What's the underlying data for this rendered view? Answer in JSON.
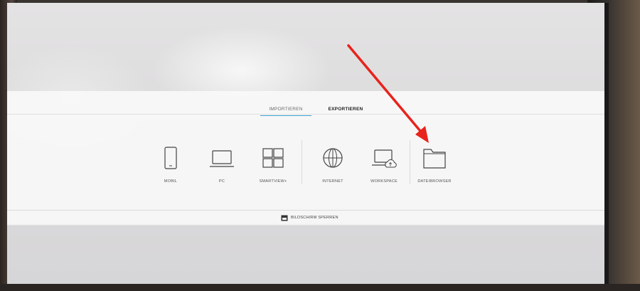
{
  "tabs": [
    {
      "label": "IMPORTIEREN",
      "active": true
    },
    {
      "label": "EXPORTIEREN",
      "active": false
    }
  ],
  "sources": [
    {
      "label": "MOBIL",
      "icon": "phone-icon"
    },
    {
      "label": "PC",
      "icon": "laptop-icon"
    },
    {
      "label": "SMARTVIEW+",
      "icon": "grid-icon"
    },
    {
      "label": "INTERNET",
      "icon": "globe-icon"
    },
    {
      "label": "WORKSPACE",
      "icon": "cloud-laptop-icon"
    },
    {
      "label": "DATEIBROWSER",
      "icon": "folder-icon"
    }
  ],
  "lock_screen": {
    "label": "BILDSCHIRM SPERREN",
    "icon": "lock-screen-icon"
  },
  "colors": {
    "active_tab_underline": "#3aa0d0",
    "annotation_arrow": "#e8231c"
  }
}
